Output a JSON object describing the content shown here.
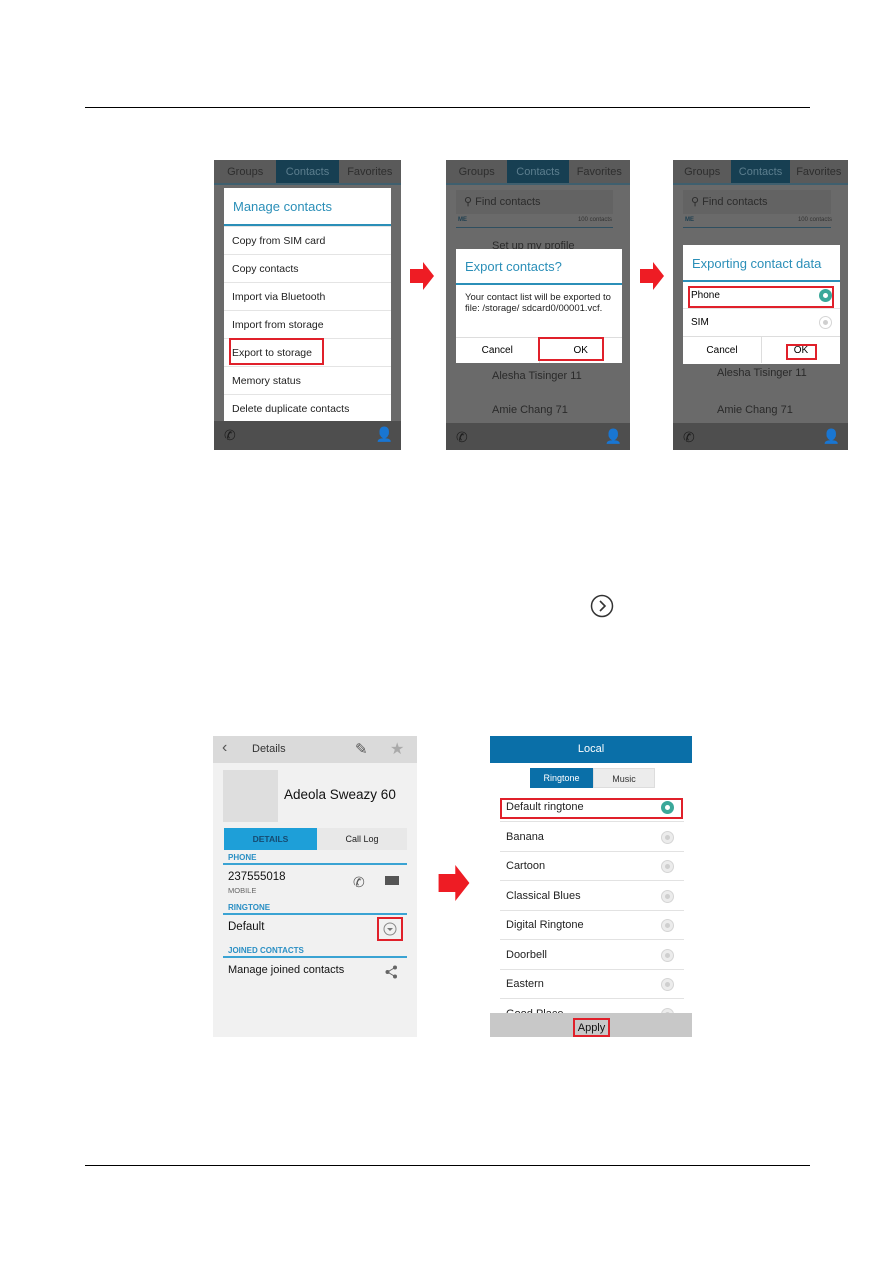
{
  "top_screens": {
    "tabs": [
      "Groups",
      "Contacts",
      "Favorites"
    ],
    "screen1": {
      "dialog_title": "Manage contacts",
      "items": [
        "Copy from SIM card",
        "Copy contacts",
        "Import via Bluetooth",
        "Import from storage",
        "Export to storage",
        "Memory status",
        "Delete duplicate contacts"
      ],
      "highlighted": "Export to storage"
    },
    "screen2": {
      "search_placeholder": "Find contacts",
      "me_label": "ME",
      "count": "100 contacts",
      "behind_item": "Set up my profile",
      "dialog_title": "Export contacts?",
      "dialog_body": "Your contact list will be exported to file: /storage/ sdcard0/00001.vcf.",
      "cancel": "Cancel",
      "ok": "OK",
      "contacts": [
        "Alesha Tisinger 11",
        "Amie Chang 71"
      ]
    },
    "screen3": {
      "search_placeholder": "Find contacts",
      "me_label": "ME",
      "count": "100 contacts",
      "dialog_title": "Exporting contact data",
      "options": [
        {
          "label": "Phone",
          "selected": true
        },
        {
          "label": "SIM",
          "selected": false
        }
      ],
      "cancel": "Cancel",
      "ok": "OK",
      "contacts": [
        "Alesha Tisinger 11",
        "Amie Chang 71"
      ]
    }
  },
  "inline_icon": "chevron-right-circle-icon",
  "details_screen": {
    "header": "Details",
    "name": "Adeola Sweazy 60",
    "tabs": [
      "DETAILS",
      "Call Log"
    ],
    "phone_label": "PHONE",
    "phone_number": "237555018",
    "phone_type": "MOBILE",
    "ringtone_label": "RINGTONE",
    "ringtone_value": "Default",
    "joined_label": "JOINED CONTACTS",
    "joined_action": "Manage joined contacts"
  },
  "ringtone_screen": {
    "header": "Local",
    "tabs": [
      "Ringtone",
      "Music"
    ],
    "items": [
      "Default ringtone",
      "Banana",
      "Cartoon",
      "Classical Blues",
      "Digital Ringtone",
      "Doorbell",
      "Eastern",
      "Good Place"
    ],
    "selected": "Default ringtone",
    "apply": "Apply"
  },
  "colors": {
    "highlight": "#e0202a",
    "arrow": "#ee1c24",
    "accent": "#2b8fb8",
    "header_blue": "#0a6fa8"
  }
}
